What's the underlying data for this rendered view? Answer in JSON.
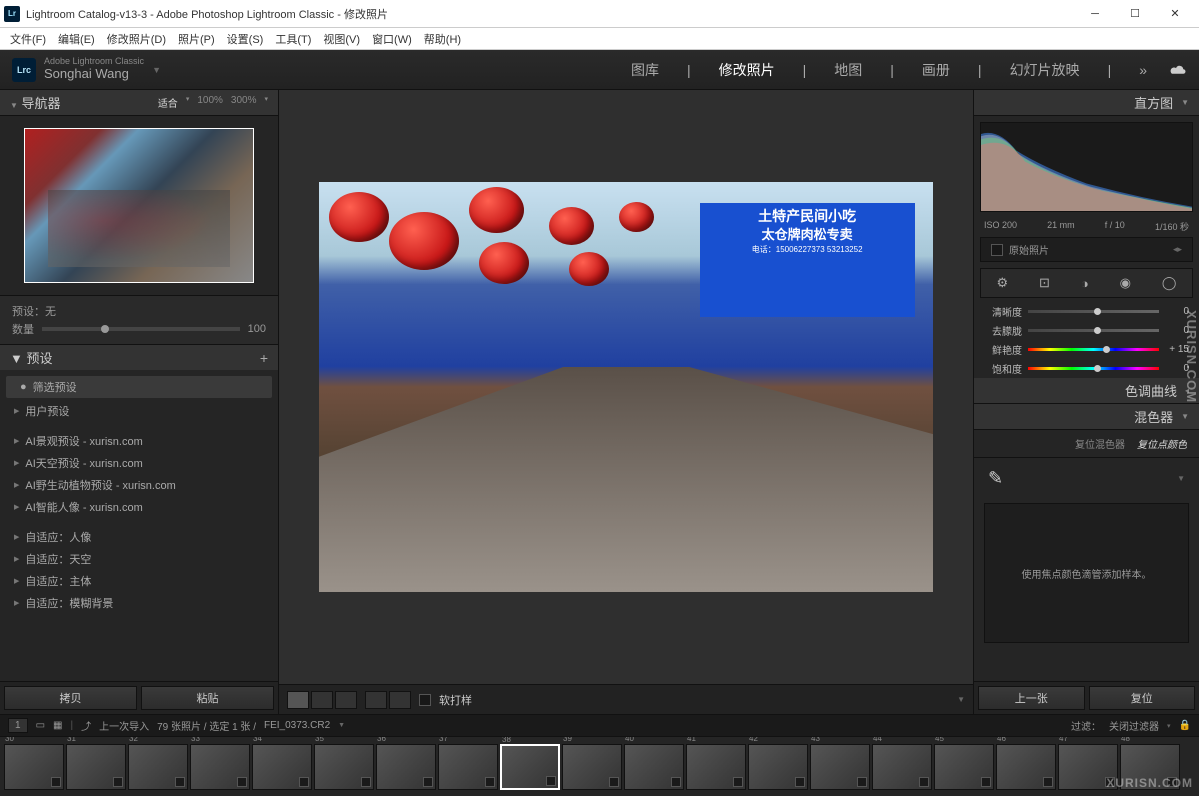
{
  "window": {
    "title": "Lightroom Catalog-v13-3 - Adobe Photoshop Lightroom Classic - 修改照片"
  },
  "menubar": [
    "文件(F)",
    "编辑(E)",
    "修改照片(D)",
    "照片(P)",
    "设置(S)",
    "工具(T)",
    "视图(V)",
    "窗口(W)",
    "帮助(H)"
  ],
  "brand": {
    "sub": "Adobe Lightroom Classic",
    "main": "Songhai Wang"
  },
  "modules": {
    "items": [
      "图库",
      "修改照片",
      "地图",
      "画册",
      "幻灯片放映"
    ],
    "active": 1,
    "more": "»"
  },
  "leftPanel": {
    "navigator": {
      "title": "导航器",
      "fit": "适合",
      "pct100": "100%",
      "pct300": "300%"
    },
    "preview": {
      "label": "预设：无",
      "numLabel": "数量",
      "numVal": "100"
    },
    "presets": {
      "title": "预设",
      "search": "筛选预设",
      "user": "用户预设",
      "items": [
        "AI景观预设 - xurisn.com",
        "AI天空预设 - xurisn.com",
        "AI野生动植物预设 - xurisn.com",
        "AI智能人像 - xurisn.com"
      ],
      "adaptive": [
        "自适应：人像",
        "自适应：天空",
        "自适应：主体",
        "自适应：模糊背景"
      ]
    },
    "buttons": {
      "copy": "拷贝",
      "paste": "粘贴"
    }
  },
  "centerToolbar": {
    "soft": "软打样"
  },
  "rightPanel": {
    "histogram": {
      "title": "直方图",
      "iso": "ISO 200",
      "focal": "21 mm",
      "fstop": "f / 10",
      "shutter": "1/160 秒"
    },
    "rawLabel": "原始照片",
    "adjust": [
      {
        "lbl": "清晰度",
        "val": "0"
      },
      {
        "lbl": "去朦胧",
        "val": "0"
      },
      {
        "lbl": "鲜艳度",
        "val": "+ 15",
        "color": true,
        "knob": "57%"
      },
      {
        "lbl": "饱和度",
        "val": "0",
        "color": true
      }
    ],
    "sections": {
      "tone": "色调曲线",
      "mixer": "混色器"
    },
    "mixerTabs": {
      "a": "复位混色器",
      "b": "复位点颜色"
    },
    "sampleMsg": "使用焦点颜色滴管添加样本。",
    "navBtns": {
      "prev": "上一张",
      "reset": "复位"
    }
  },
  "bottombar": {
    "crumb": "上一次导入",
    "count": "79 张照片 / 选定 1 张 /",
    "filename": "FEI_0373.CR2",
    "filter": "过滤：",
    "filterOff": "关闭过滤器",
    "pageStart": "1"
  },
  "filmstrip": {
    "start": 30,
    "count": 19,
    "selected": 38
  },
  "signText": {
    "l1": "土特产民间小吃",
    "l2": "太仓牌肉松专卖",
    "l3": "电话：15006227373 53213252"
  },
  "watermark": "XURISN.COM"
}
